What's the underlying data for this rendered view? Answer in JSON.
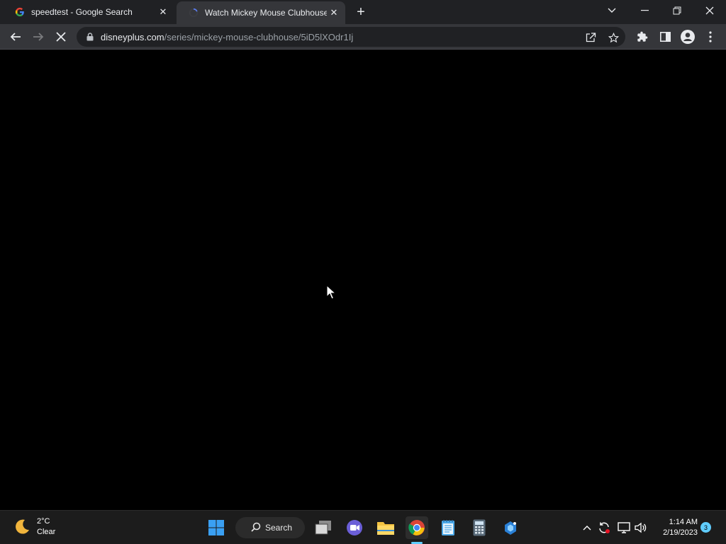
{
  "browser": {
    "tabs": [
      {
        "title": "speedtest - Google Search",
        "favicon": "google-icon",
        "active": false
      },
      {
        "title": "Watch Mickey Mouse Clubhouse",
        "favicon": "loading-spinner-icon",
        "active": true
      }
    ],
    "address": {
      "host": "disneyplus.com",
      "path": "/series/mickey-mouse-clubhouse/5iD5lXOdr1Ij"
    },
    "accent": "#35363a"
  },
  "taskbar": {
    "weather": {
      "temp": "2°C",
      "condition": "Clear"
    },
    "search_label": "Search",
    "clock": {
      "time": "1:14 AM",
      "date": "2/19/2023"
    },
    "notification_count": "3",
    "accent": "#60cdff"
  }
}
